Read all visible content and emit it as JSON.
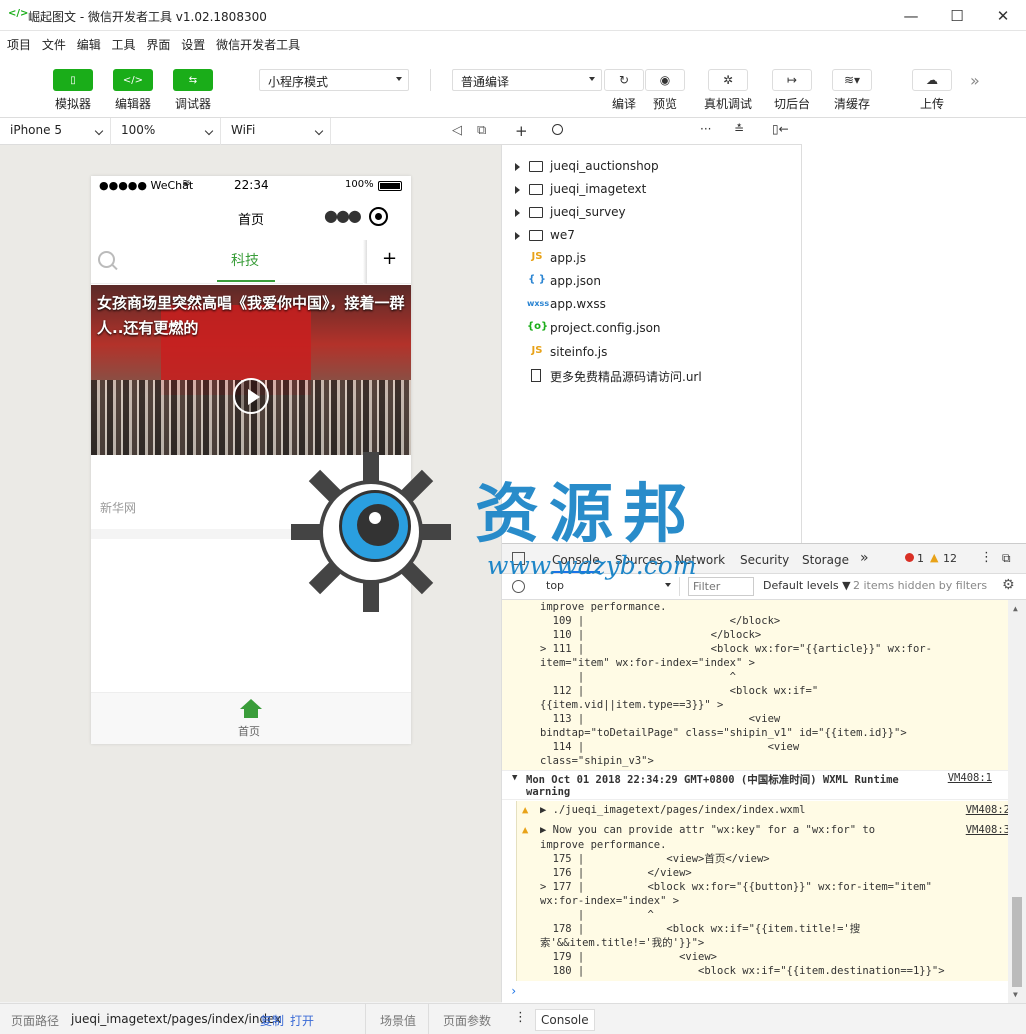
{
  "window": {
    "title": "崛起图文 - 微信开发者工具 v1.02.1808300",
    "min": "—",
    "max": "☐",
    "close": "✕"
  },
  "menu": [
    "项目",
    "文件",
    "编辑",
    "工具",
    "界面",
    "设置",
    "微信开发者工具"
  ],
  "toolbar": {
    "simulator": "模拟器",
    "editor": "编辑器",
    "debugger": "调试器",
    "mode": "小程序模式",
    "compile_mode": "普通编译",
    "compile": "编译",
    "preview": "预览",
    "remote_debug": "真机调试",
    "background": "切后台",
    "clear_cache": "清缓存",
    "upload": "上传"
  },
  "simbar": {
    "device": "iPhone 5",
    "zoom": "100%",
    "network": "WiFi"
  },
  "phone": {
    "status_carrier": "●●●●● WeChat",
    "status_time": "22:34",
    "status_battery": "100%",
    "nav_title": "首页",
    "tab_active": "科技",
    "add": "+",
    "article_title": "女孩商场里突然高唱《我爱你中国》，接着一群人..还有更燃的",
    "source": "新华网",
    "tab_home": "首页"
  },
  "files": [
    {
      "name": "jueqi_auctionshop",
      "type": "folder"
    },
    {
      "name": "jueqi_imagetext",
      "type": "folder"
    },
    {
      "name": "jueqi_survey",
      "type": "folder"
    },
    {
      "name": "we7",
      "type": "folder"
    },
    {
      "name": "app.js",
      "type": "js",
      "icon": "JS"
    },
    {
      "name": "app.json",
      "type": "json",
      "icon": "{ }"
    },
    {
      "name": "app.wxss",
      "type": "wxss",
      "icon": "wxss"
    },
    {
      "name": "project.config.json",
      "type": "config",
      "icon": "{o}"
    },
    {
      "name": "siteinfo.js",
      "type": "js",
      "icon": "JS"
    },
    {
      "name": "更多免费精品源码请访问.url",
      "type": "file"
    }
  ],
  "watermark": {
    "brand": "资源邦",
    "url": "www.wazyb.com"
  },
  "devtools": {
    "tabs": [
      "Console",
      "Sources",
      "Network",
      "Security",
      "Storage"
    ],
    "more": "»",
    "errors": "1",
    "warnings": "12",
    "context": "top",
    "filter_placeholder": "Filter",
    "levels": "Default levels ▼",
    "hidden": "2 items hidden by filters"
  },
  "console": {
    "lines1": [
      "improve performance.",
      "  109 |                       </block>",
      "  110 |                    </block>",
      "> 111 |                    <block wx:for=\"{{article}}\" wx:for-",
      "item=\"item\" wx:for-index=\"index\" >",
      "      |                       ^",
      "  112 |                       <block wx:if=\"",
      "{{item.vid||item.type==3}}\" >",
      "  113 |                          <view",
      "bindtap=\"toDetailPage\" class=\"shipin_v1\" id=\"{{item.id}}\">",
      "  114 |                             <view",
      "class=\"shipin_v3\">"
    ],
    "group_header": "Mon Oct 01 2018 22:34:29 GMT+0800 (中国标准时间) WXML Runtime",
    "group_header2": "warning",
    "vm1": "VM408:1",
    "warn1": "▶ ./jueqi_imagetext/pages/index/index.wxml",
    "vm2": "VM408:2",
    "warn2": "▶ Now you can provide attr \"wx:key\" for a \"wx:for\" to",
    "vm3": "VM408:3",
    "lines2": [
      "improve performance.",
      "  175 |             <view>首页</view>",
      "  176 |          </view>",
      "> 177 |          <block wx:for=\"{{button}}\" wx:for-item=\"item\"",
      "wx:for-index=\"index\" >",
      "      |          ^",
      "  178 |             <block wx:if=\"{{item.title!='搜",
      "索'&&item.title!='我的'}}\">",
      "  179 |               <view>",
      "  180 |                  <block wx:if=\"{{item.destination==1}}\">"
    ],
    "prompt": "›"
  },
  "status": {
    "path_label": "页面路径",
    "path": "jueqi_imagetext/pages/index/index",
    "copy": "复制",
    "open": "打开",
    "scene": "场景值",
    "params": "页面参数"
  },
  "drawer": {
    "console": "Console"
  }
}
